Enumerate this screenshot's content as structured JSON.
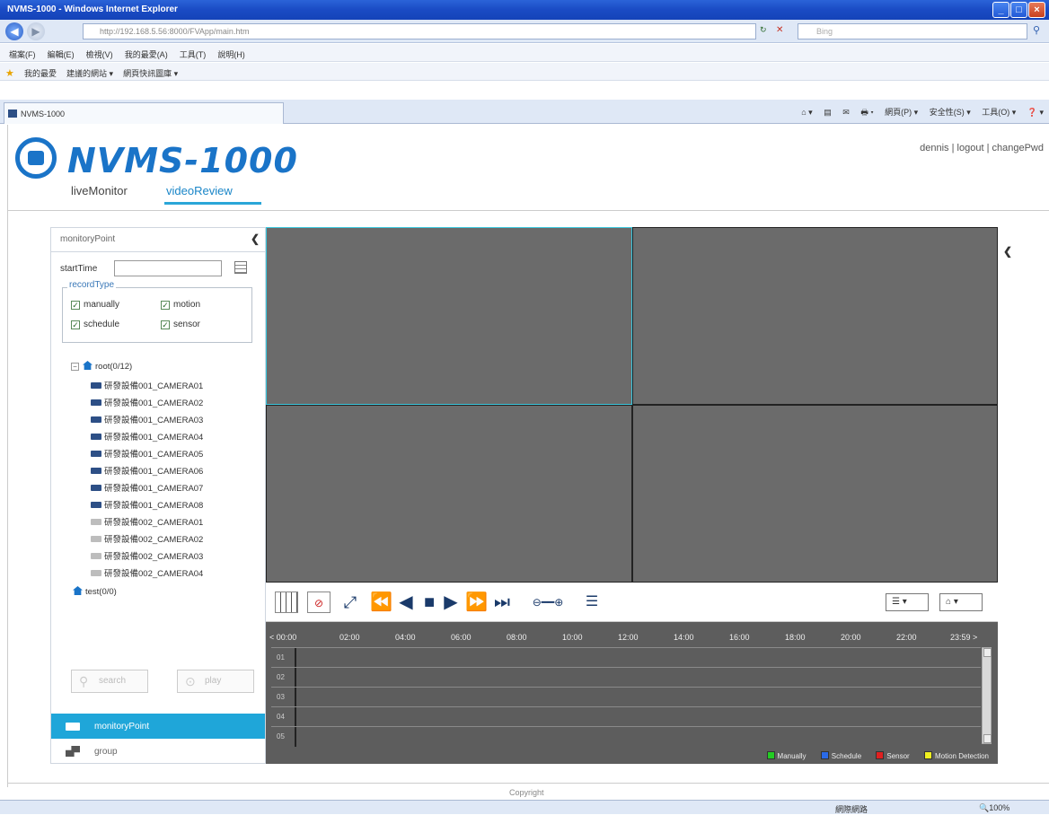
{
  "browser": {
    "window_title": "NVMS-1000 - Windows Internet Explorer",
    "url": "http://192.168.5.56:8000/FVApp/main.htm",
    "search_placeholder": "Bing",
    "menus": [
      "檔案(F)",
      "編輯(E)",
      "檢視(V)",
      "我的最愛(A)",
      "工具(T)",
      "說明(H)"
    ],
    "favorites_label": "我的最愛",
    "fav_items": [
      "建議的網站 ▾",
      "網頁快訊圖庫 ▾"
    ],
    "tab_title": "NVMS-1000",
    "commands": [
      "⌂ ▾",
      "▤",
      "✉",
      "🖶 ▾",
      "網頁(P) ▾",
      "安全性(S) ▾",
      "工具(O) ▾",
      "❓ ▾"
    ],
    "status_zone": "網際網路",
    "status_zoom": "🔍100%"
  },
  "app": {
    "logo_text": "NVMS-1000",
    "user": "dennis",
    "logout": "logout",
    "change_pwd": "changePwd",
    "sep": "|",
    "nav": {
      "live": "liveMonitor",
      "video": "videoReview"
    },
    "copyright": "Copyright"
  },
  "left_panel": {
    "title": "monitoryPoint",
    "start_label": "startTime",
    "start_value": "",
    "record_type_legend": "recordType",
    "record_types": {
      "manually": "manually",
      "motion": "motion",
      "schedule": "schedule",
      "sensor": "sensor"
    },
    "tree": {
      "root": "root(0/12)",
      "cameras": [
        "研發設備001_CAMERA01",
        "研發設備001_CAMERA02",
        "研發設備001_CAMERA03",
        "研發設備001_CAMERA04",
        "研發設備001_CAMERA05",
        "研發設備001_CAMERA06",
        "研發設備001_CAMERA07",
        "研發設備001_CAMERA08",
        "研發設備002_CAMERA01",
        "研發設備002_CAMERA02",
        "研發設備002_CAMERA03",
        "研發設備002_CAMERA04"
      ],
      "test": "test(0/0)"
    },
    "search_btn": "search",
    "play_btn": "play",
    "nav_monitor": "monitoryPoint",
    "nav_group": "group"
  },
  "timeline": {
    "ticks": [
      "< 00:00",
      "02:00",
      "04:00",
      "06:00",
      "08:00",
      "10:00",
      "12:00",
      "14:00",
      "16:00",
      "18:00",
      "20:00",
      "22:00",
      "23:59 >"
    ],
    "tracks": [
      "01",
      "02",
      "03",
      "04",
      "05"
    ],
    "legend": {
      "manually": "Manually",
      "schedule": "Schedule",
      "sensor": "Sensor",
      "motion": "Motion Detection"
    },
    "legend_colors": {
      "manually": "#22cc22",
      "schedule": "#2a6ae8",
      "sensor": "#e02020",
      "motion": "#f0f020"
    }
  },
  "colors": {
    "accent": "#1fa6d9",
    "brand": "#1a74c8",
    "selected_pane": "#3cc8de"
  }
}
